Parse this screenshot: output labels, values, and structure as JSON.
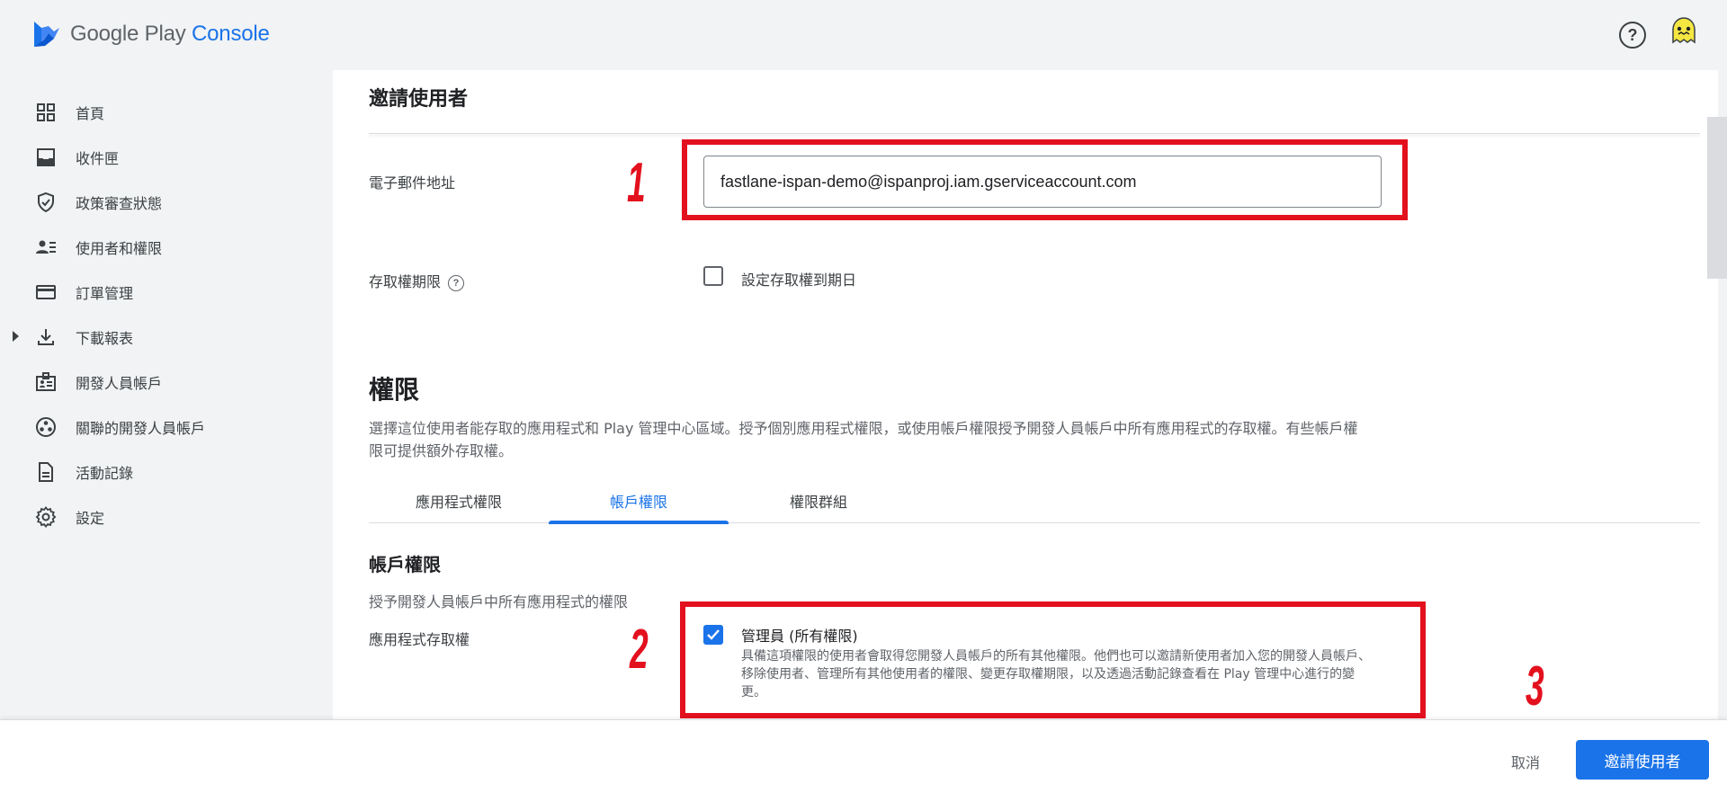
{
  "app": {
    "brand_name": "Google Play",
    "brand_suffix": "Console"
  },
  "header": {
    "help_icon": "help-circle-icon",
    "help_glyph": "?",
    "avatar_icon": "ghost-avatar-icon"
  },
  "sidebar": {
    "items": [
      {
        "label": "首頁",
        "icon": "dashboard-grid-icon"
      },
      {
        "label": "收件匣",
        "icon": "inbox-icon"
      },
      {
        "label": "政策審查狀態",
        "icon": "shield-check-icon"
      },
      {
        "label": "使用者和權限",
        "icon": "people-icon"
      },
      {
        "label": "訂單管理",
        "icon": "credit-card-icon"
      },
      {
        "label": "下載報表",
        "icon": "download-icon"
      },
      {
        "label": "開發人員帳戶",
        "icon": "badge-icon"
      },
      {
        "label": "關聯的開發人員帳戶",
        "icon": "linked-circles-icon"
      },
      {
        "label": "活動記錄",
        "icon": "document-icon"
      },
      {
        "label": "設定",
        "icon": "gear-icon"
      }
    ]
  },
  "form": {
    "title": "邀請使用者",
    "email_label": "電子郵件地址",
    "email_value": "fastlane-ispan-demo@ispanproj.iam.gserviceaccount.com",
    "expiry_label": "存取權期限",
    "expiry_help_glyph": "?",
    "expiry_checkbox_label": "設定存取權到期日",
    "expiry_checked": false
  },
  "permissions": {
    "title": "權限",
    "description": "選擇這位使用者能存取的應用程式和 Play 管理中心區域。授予個別應用程式權限，或使用帳戶權限授予開發人員帳戶中所有應用程式的存取權。有些帳戶權限可提供額外存取權。",
    "tabs": [
      {
        "label": "應用程式權限",
        "active": false
      },
      {
        "label": "帳戶權限",
        "active": true
      },
      {
        "label": "權限群組",
        "active": false
      }
    ],
    "account": {
      "title": "帳戶權限",
      "description": "授予開發人員帳戶中所有應用程式的權限",
      "app_access_label": "應用程式存取權",
      "admin_title": "管理員 (所有權限)",
      "admin_description": "具備這項權限的使用者會取得您開發人員帳戶的所有其他權限。他們也可以邀請新使用者加入您的開發人員帳戶、移除使用者、管理所有其他使用者的權限、變更存取權期限，以及透過活動記錄查看在 Play 管理中心進行的變更。",
      "admin_checked": true
    }
  },
  "annotations": {
    "step1": "1",
    "step2": "2",
    "step3": "3",
    "color": "#e3101e"
  },
  "footer": {
    "cancel_label": "取消",
    "invite_label": "邀請使用者"
  },
  "colors": {
    "accent": "#1a73e8",
    "background": "#f1f3f4",
    "surface": "#ffffff"
  }
}
